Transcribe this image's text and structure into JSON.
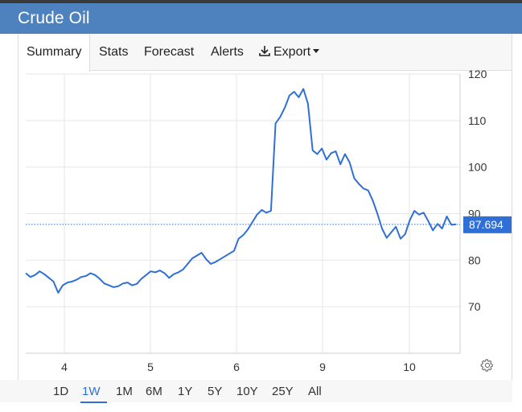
{
  "app": {
    "title": "Crude Oil"
  },
  "tabs": [
    {
      "label": "Summary",
      "active": true
    },
    {
      "label": "Stats"
    },
    {
      "label": "Forecast"
    },
    {
      "label": "Alerts"
    },
    {
      "label": "Export",
      "icon": "download-icon",
      "dropdown": true
    }
  ],
  "ranges": {
    "items": [
      "1D",
      "1W",
      "1M",
      "6M",
      "1Y",
      "5Y",
      "10Y",
      "25Y",
      "All"
    ],
    "active": "1W"
  },
  "settings_icon": "gear-icon",
  "colors": {
    "header": "#4d82bf",
    "line": "#2f6fd6",
    "price_badge": "#2f6fd6"
  },
  "chart_data": {
    "type": "line",
    "title": "",
    "xlabel": "",
    "ylabel": "",
    "x_ticks": [
      4,
      5,
      6,
      9,
      10
    ],
    "y_ticks": [
      70,
      80,
      90,
      100,
      110,
      120
    ],
    "ylim": [
      60,
      120
    ],
    "y_axis_side": "right",
    "grid": true,
    "last_price": "87.694",
    "series": [
      {
        "values": [
          77.2,
          76.4,
          76.8,
          77.6,
          77.0,
          76.2,
          75.4,
          73.0,
          74.6,
          75.2,
          75.4,
          75.8,
          76.4,
          76.6,
          77.2,
          76.8,
          76.0,
          75.0,
          74.6,
          74.2,
          74.4,
          75.0,
          75.2,
          74.6,
          74.9,
          76.0,
          76.8,
          77.6,
          77.4,
          77.8,
          77.2,
          76.2,
          77.0,
          77.4,
          78.0,
          79.2,
          80.4,
          81.0,
          81.6,
          80.2,
          79.2,
          79.6,
          80.2,
          80.8,
          81.4,
          82.0,
          84.6,
          85.4,
          86.6,
          88.2,
          89.8,
          90.8,
          90.2,
          90.6,
          109.4,
          110.8,
          112.8,
          115.4,
          116.2,
          115.0,
          116.8,
          113.6,
          103.6,
          102.8,
          104.0,
          101.6,
          103.0,
          103.4,
          100.6,
          102.8,
          101.0,
          97.6,
          96.4,
          95.4,
          95.0,
          92.8,
          90.0,
          86.8,
          84.8,
          86.0,
          87.2,
          84.6,
          85.6,
          88.6,
          90.6,
          89.8,
          90.2,
          88.4,
          86.4,
          87.8,
          86.8,
          89.4,
          87.6,
          87.694
        ]
      }
    ]
  }
}
